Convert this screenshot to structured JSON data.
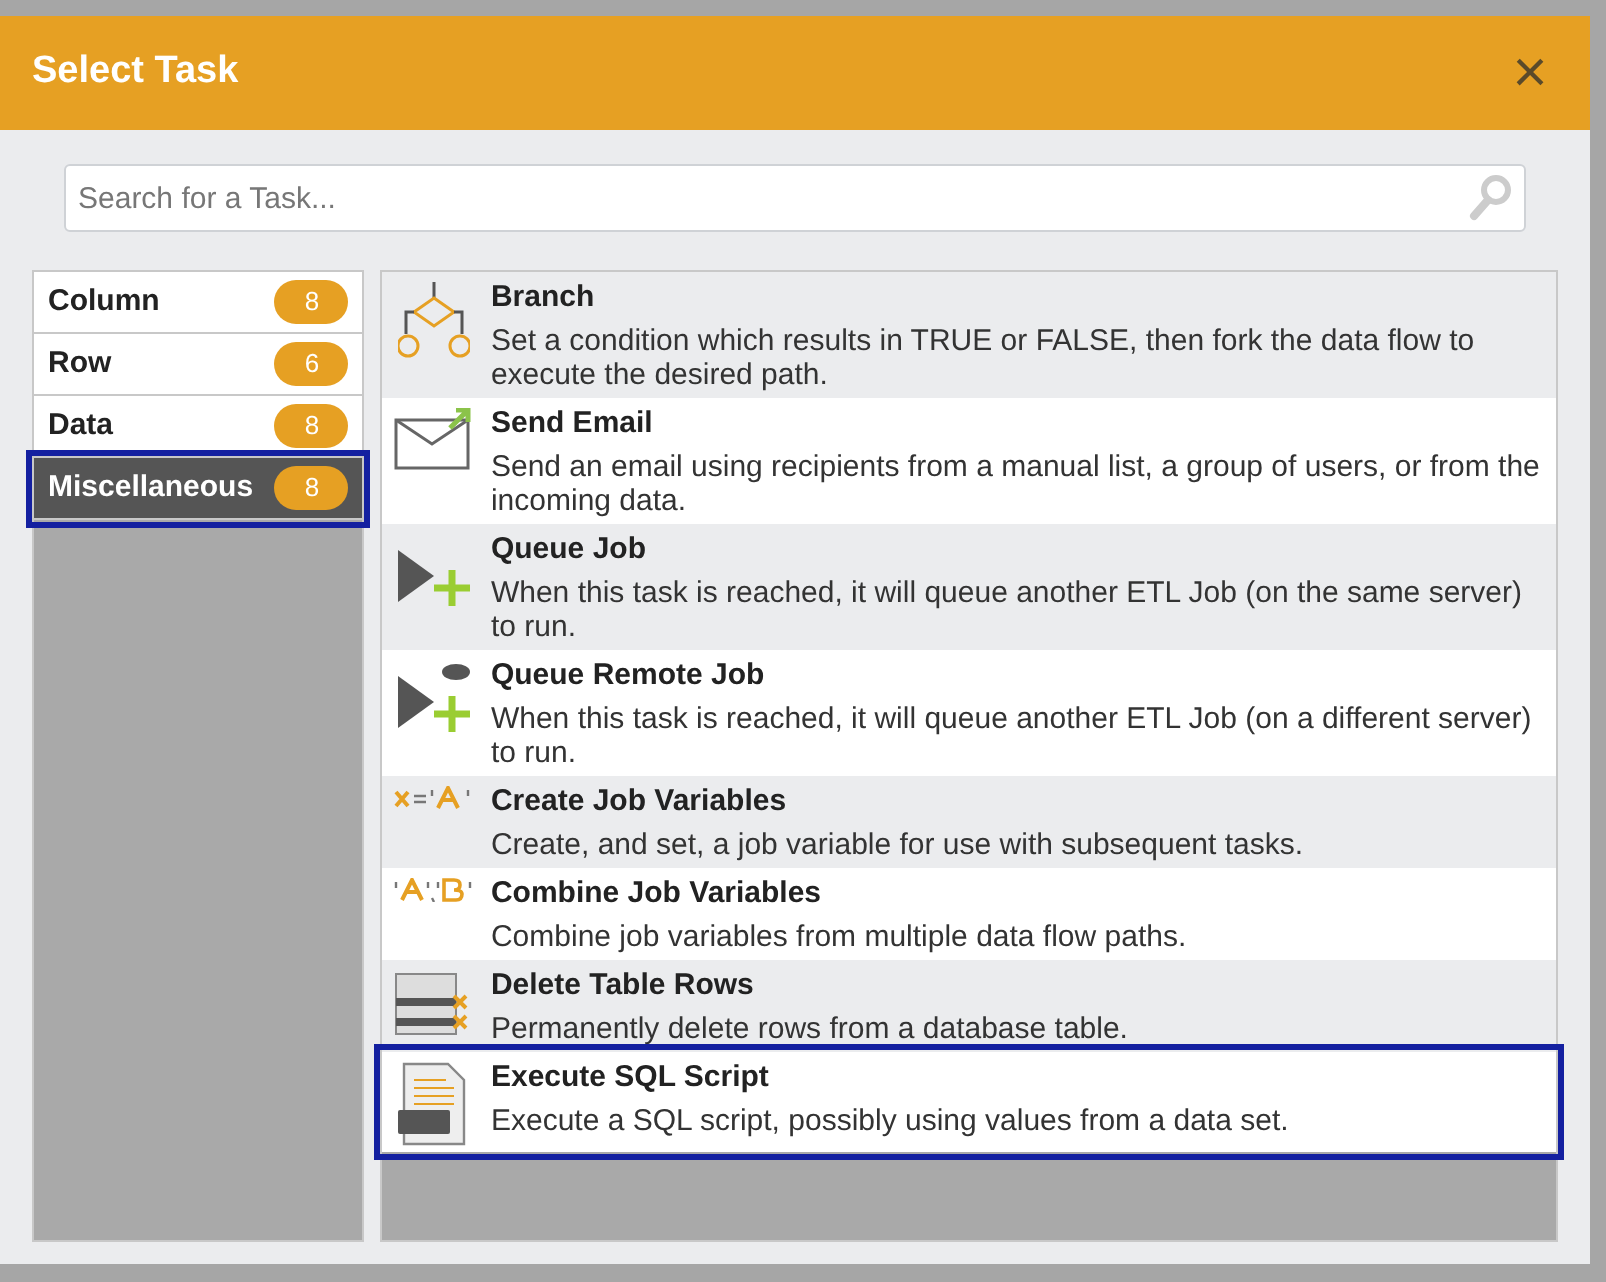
{
  "dialog": {
    "title": "Select Task",
    "close_label": "×"
  },
  "search": {
    "placeholder": "Search for a Task..."
  },
  "categories": [
    {
      "label": "Column",
      "count": "8",
      "selected": false,
      "highlighted": false
    },
    {
      "label": "Row",
      "count": "6",
      "selected": false,
      "highlighted": false
    },
    {
      "label": "Data",
      "count": "8",
      "selected": false,
      "highlighted": false
    },
    {
      "label": "Miscellaneous",
      "count": "8",
      "selected": true,
      "highlighted": true
    }
  ],
  "tasks": [
    {
      "kind": "branch",
      "title": "Branch",
      "description": "Set a condition which results in TRUE or FALSE, then fork the data flow to execute the desired path.",
      "highlighted": false
    },
    {
      "kind": "email",
      "title": "Send Email",
      "description": "Send an email using recipients from a manual list, a group of users, or from the incoming data.",
      "highlighted": false
    },
    {
      "kind": "queue",
      "title": "Queue Job",
      "description": "When this task is reached, it will queue another ETL Job (on the same server) to run.",
      "highlighted": false
    },
    {
      "kind": "remote",
      "title": "Queue Remote Job",
      "description": "When this task is reached, it will queue another ETL Job (on a different server) to run.",
      "highlighted": false
    },
    {
      "kind": "create",
      "title": "Create Job Variables",
      "description": "Create, and set, a job variable for use with subsequent tasks.",
      "highlighted": false
    },
    {
      "kind": "combine",
      "title": "Combine Job Variables",
      "description": "Combine job variables from multiple data flow paths.",
      "highlighted": false
    },
    {
      "kind": "delete",
      "title": "Delete Table Rows",
      "description": "Permanently delete rows from a database table.",
      "highlighted": false
    },
    {
      "kind": "sql",
      "title": "Execute SQL Script",
      "description": "Execute a SQL script, possibly using values from a data set.",
      "highlighted": true
    }
  ]
}
